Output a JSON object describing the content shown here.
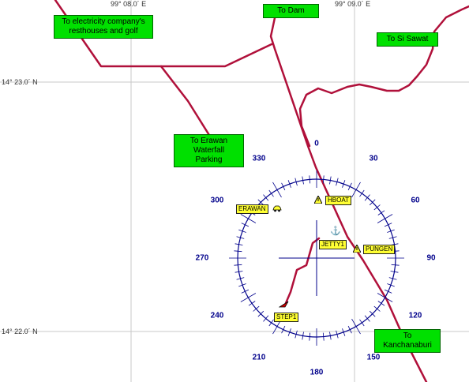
{
  "grid": {
    "lon_left": "99° 08.0´ E",
    "lon_right": "99° 09.0´ E",
    "lat_top": "14° 23.0´ N",
    "lat_bottom": "14° 22.0´ N"
  },
  "destinations": {
    "electricity": "To electricity company's\nresthouses and golf",
    "dam": "To Dam",
    "si_sawat": "To Si Sawat",
    "erawan_parking": "To Erawan\nWaterfall Parking",
    "kanchanaburi": "To Kanchanaburi"
  },
  "compass": {
    "labels": [
      "0",
      "30",
      "60",
      "90",
      "120",
      "150",
      "180",
      "210",
      "240",
      "270",
      "300",
      "330"
    ]
  },
  "waypoints": {
    "hboat": "HBOAT",
    "erawan": "ERAWAN",
    "jetty1": "JETTY1",
    "pungen": "PUNGEN",
    "step1": "STEP1"
  },
  "icons": {
    "hboat": "warning-triangle-icon",
    "erawan": "car-icon",
    "jetty1": "anchor-icon",
    "pungen": "warning-triangle-icon",
    "step1": "position-arrow-icon"
  },
  "colors": {
    "road": "#b0103a",
    "compass": "#00008b",
    "label_bg": "#00e000",
    "waypoint_bg": "#ffff33",
    "grid": "#c8c8c8"
  }
}
